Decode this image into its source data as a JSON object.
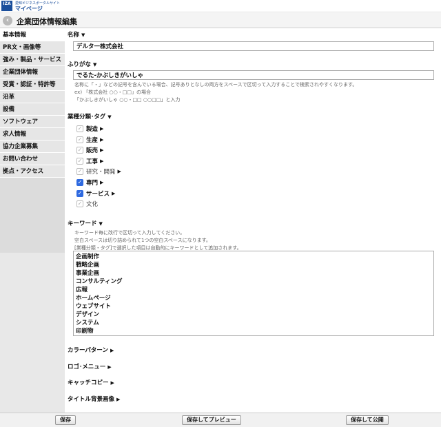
{
  "header": {
    "logo_text": "IZA",
    "brand_sub": "愛知ビジネスポータルサイト",
    "brand_main": "マイページ"
  },
  "titlebar": {
    "title": "企業団体情報編集"
  },
  "sidebar": {
    "items": [
      {
        "label": "基本情報",
        "active": true
      },
      {
        "label": "PR文・画像等"
      },
      {
        "label": "強み・製品・サービス"
      },
      {
        "label": "企業団体情報"
      },
      {
        "label": "受賞・認証・特許等"
      },
      {
        "label": "沿革"
      },
      {
        "label": "設備"
      },
      {
        "label": "ソフトウェア"
      },
      {
        "label": "求人情報"
      },
      {
        "label": "協力企業募集"
      },
      {
        "label": "お問い合わせ"
      },
      {
        "label": "拠点・アクセス"
      }
    ]
  },
  "form": {
    "name_label": "名称",
    "name_value": "デルタ一株式会社",
    "furigana_label": "ふりがな",
    "furigana_value": "でるた-かぶしきがいしゃ",
    "furigana_hint1": "名称に「・」などの記号を含んでいる場合、記号ありとなしの両方をスペースで区切って入力することで検索されやすくなります。",
    "furigana_hint2": "ex) 「株式会社 ○○・□□」の場合",
    "furigana_hint3": "「かぶしきがいしゃ ○○・□□ ○○□□」と入力",
    "category_label": "業種分類･タグ",
    "categories": [
      {
        "label": "製造",
        "checked": false
      },
      {
        "label": "生産",
        "checked": false
      },
      {
        "label": "販売",
        "checked": false
      },
      {
        "label": "工事",
        "checked": false
      },
      {
        "label": "研究・開発",
        "checked": false
      },
      {
        "label": "専門",
        "checked": true
      },
      {
        "label": "サービス",
        "checked": true
      },
      {
        "label": "文化",
        "checked": false,
        "no_arrow": true
      }
    ],
    "keyword_label": "キーワード",
    "keyword_hint1": "キーワード毎に改行で区切って入力してください。",
    "keyword_hint2": "空白スペースは切り詰められて1つの空白スペースになります。",
    "keyword_hint3": "[業種分類・タグ]で選択した項目は自動的にキーワードとして追加されます。",
    "keywords": [
      "企画制作",
      "戦略企画",
      "事業企画",
      "コンサルティング",
      "広報",
      "ホームページ",
      "ウェブサイト",
      "デザイン",
      "システム",
      "印刷物"
    ],
    "collapsed_sections": [
      "カラーパターン",
      "ロゴ･メニュー",
      "キャッチコピー",
      "タイトル背景画像"
    ]
  },
  "footer": {
    "save": "保存",
    "save_preview": "保存してプレビュー",
    "save_publish": "保存して公開"
  },
  "icons": {
    "back": "chevron-left-icon",
    "expand": "triangle-down-icon",
    "collapsed": "triangle-right-icon"
  },
  "colors": {
    "brand": "#1b4f9c",
    "checkbox_on": "#2f6ae0"
  }
}
